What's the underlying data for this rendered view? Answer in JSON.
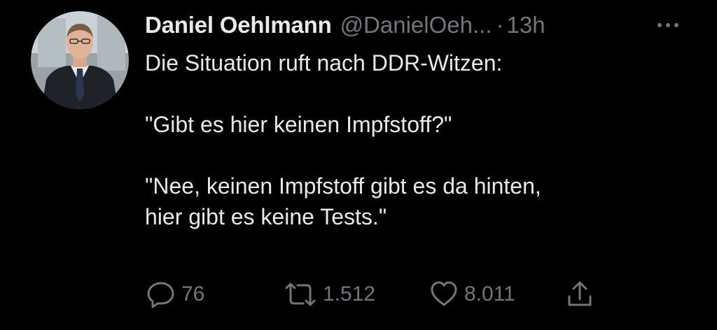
{
  "tweet": {
    "author": {
      "name": "Daniel Oehlmann",
      "handle": "@DanielOeh...",
      "separator": "·",
      "time": "13h"
    },
    "body": {
      "line1": "Die Situation ruft nach DDR-Witzen:",
      "line2": "\"Gibt es hier keinen Impfstoff?\"",
      "line3": "\"Nee, keinen Impfstoff gibt es da hinten,",
      "line4": "hier gibt es keine Tests.\""
    },
    "actions": {
      "replies": "76",
      "retweets": "1.512",
      "likes": "8.011"
    }
  },
  "icons": {
    "more": "more-horizontal-icon",
    "reply": "reply-icon",
    "retweet": "retweet-icon",
    "like": "heart-icon",
    "share": "share-icon"
  },
  "colors": {
    "background": "#000000",
    "text": "#e7e9ea",
    "muted": "#71767b"
  }
}
